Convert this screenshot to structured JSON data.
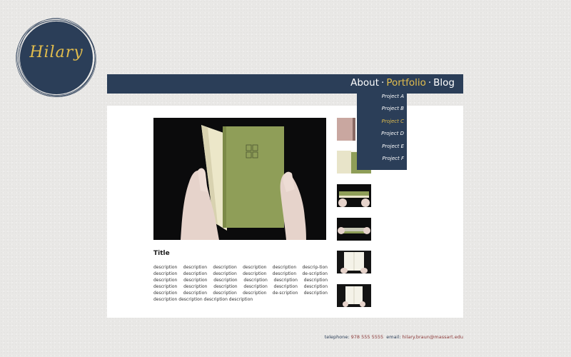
{
  "logo": {
    "text": "Hilary",
    "circle_color": "#2b3e58",
    "text_color": "#e2bd4d"
  },
  "nav": {
    "items": [
      {
        "label": "About",
        "active": false
      },
      {
        "label": "Portfolio",
        "active": true
      },
      {
        "label": "Blog",
        "active": false
      }
    ],
    "separator": "·"
  },
  "dropdown": {
    "items": [
      {
        "label": "Project A",
        "active": false
      },
      {
        "label": "Project B",
        "active": false
      },
      {
        "label": "Project C",
        "active": true
      },
      {
        "label": "Project D",
        "active": false
      },
      {
        "label": "Project E",
        "active": false
      },
      {
        "label": "Project F",
        "active": false
      }
    ]
  },
  "project": {
    "title": "Title",
    "description": "description description description description description descrip-tion description description description description description de-scription description description description description description description description description description description description description description description description description de-scription description description description description description"
  },
  "thumbnails": [
    {
      "name": "thumb-1"
    },
    {
      "name": "thumb-2"
    },
    {
      "name": "thumb-3"
    },
    {
      "name": "thumb-4"
    },
    {
      "name": "thumb-5"
    },
    {
      "name": "thumb-6"
    }
  ],
  "footer": {
    "telephone_label": "telephone:",
    "telephone_value": "978 555 5555",
    "email_label": "email:",
    "email_value": "hilary.braun@massart.edu"
  },
  "colors": {
    "accent": "#e2bd4d",
    "navy": "#2b3e58",
    "background": "#e9e8e6",
    "book_green": "#8f9e58"
  }
}
